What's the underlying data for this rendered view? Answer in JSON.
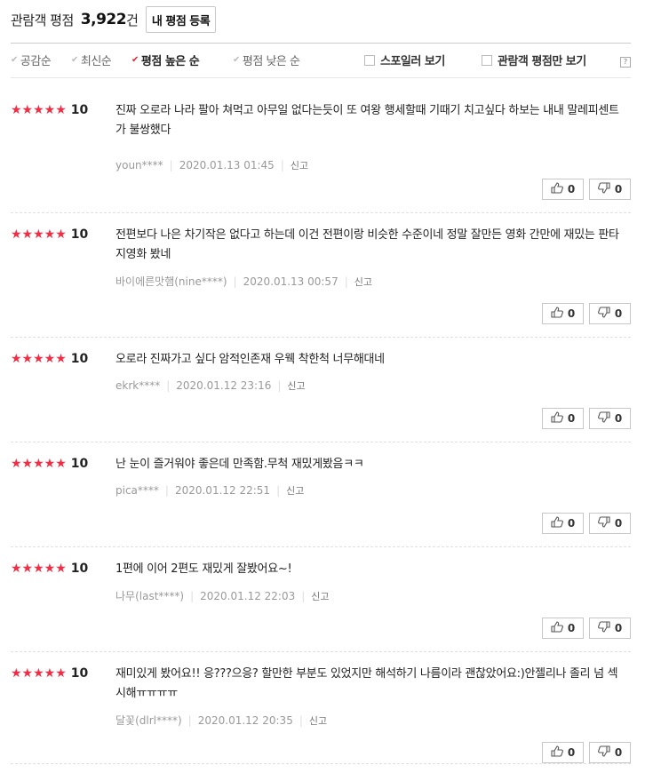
{
  "header": {
    "title": "관람객 평점",
    "count": "3,922",
    "count_unit": "건",
    "register_label": "내 평점 등록"
  },
  "sort": {
    "items": [
      {
        "label": "공감순",
        "active": false
      },
      {
        "label": "최신순",
        "active": false
      },
      {
        "label": "평점 높은 순",
        "active": true
      },
      {
        "label": "평점 낮은 순",
        "active": false
      }
    ],
    "spoiler_label": "스포일러 보기",
    "audience_only_label": "관람객 평점만 보기",
    "help_label": "?"
  },
  "colors": {
    "star": "#ef2d44",
    "accent": "#e6232f"
  },
  "report_label": "신고",
  "reviews": [
    {
      "stars": "★★★★★",
      "score": "10",
      "text": "진짜 오로라 나라 팔아 쳐먹고 아무일 없다는듯이 또 여왕 행세할때 기때기 치고싶다 하보는 내내 말레피센트가 불쌍했다",
      "user": "youn****",
      "date": "2020.01.13 01:45",
      "likes": "0",
      "dislikes": "0"
    },
    {
      "stars": "★★★★★",
      "score": "10",
      "text": "전편보다 나은 차기작은 없다고 하는데 이건 전편이랑 비슷한 수준이네 정말 잘만든 영화 간만에 재밌는 판타지영화 봤네",
      "user": "바이에른맛햄(nine****)",
      "date": "2020.01.13 00:57",
      "likes": "0",
      "dislikes": "0"
    },
    {
      "stars": "★★★★★",
      "score": "10",
      "text": "오로라 진짜가고 싶다 암적인존재 우웩 착한척 너무해대네",
      "user": "ekrk****",
      "date": "2020.01.12 23:16",
      "likes": "0",
      "dislikes": "0"
    },
    {
      "stars": "★★★★★",
      "score": "10",
      "text": "난 눈이 즐거워야 좋은데 만족함.무척 재밌게봤음ㅋㅋ",
      "user": "pica****",
      "date": "2020.01.12 22:51",
      "likes": "0",
      "dislikes": "0"
    },
    {
      "stars": "★★★★★",
      "score": "10",
      "text": "1편에 이어 2편도 재밌게 잘봤어요~!",
      "user": "나무(last****)",
      "date": "2020.01.12 22:03",
      "likes": "0",
      "dislikes": "0"
    },
    {
      "stars": "★★★★★",
      "score": "10",
      "text": "재미있게 봤어요!! 응???으응? 할만한 부분도 있었지만 해석하기 나름이라 괜찮았어요:)안젤리나 졸리 넘 섹시해ㅠㅠㅠㅠ",
      "user": "달꽃(dlrl****)",
      "date": "2020.01.12 20:35",
      "likes": "0",
      "dislikes": "0"
    }
  ]
}
